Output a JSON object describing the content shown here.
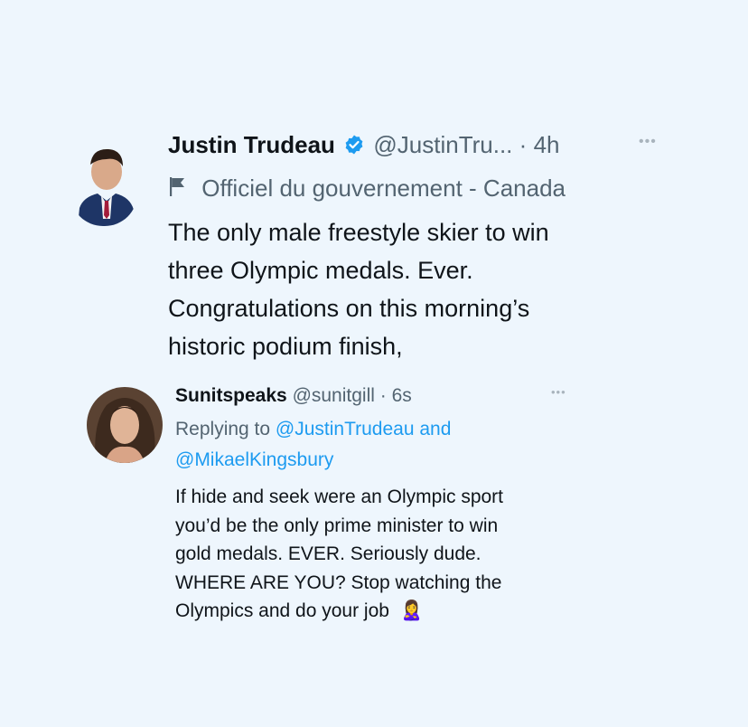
{
  "main_tweet": {
    "author_name": "Justin Trudeau",
    "handle": "@JustinTru...",
    "separator": "·",
    "time": "4h",
    "verified_icon": "verified-badge-icon",
    "label_icon": "flag-icon",
    "label": "Officiel du gouvernement - Canada",
    "text_lines": [
      "The only male freestyle skier to win",
      "three Olympic medals. Ever.",
      "Congratulations on this morning’s",
      "historic podium finish,"
    ]
  },
  "reply_tweet": {
    "author_name": "Sunitspeaks",
    "handle": "@sunitgill",
    "separator": "·",
    "time": "6s",
    "replying_prefix": "Replying to",
    "replying_to_1": "@JustinTrudeau",
    "replying_and": "and",
    "replying_to_2": "@MikaelKingsbury",
    "text_lines": [
      "If hide and seek were an Olympic sport",
      "you’d be the only prime minister to win",
      "gold medals. EVER. Seriously dude.",
      "WHERE ARE YOU? Stop watching the",
      "Olympics and do your job"
    ],
    "emoji": "🙎‍♀️"
  },
  "colors": {
    "background": "#eef6fd",
    "link": "#1d9bf0",
    "muted": "#536471",
    "text": "#0f1419"
  }
}
